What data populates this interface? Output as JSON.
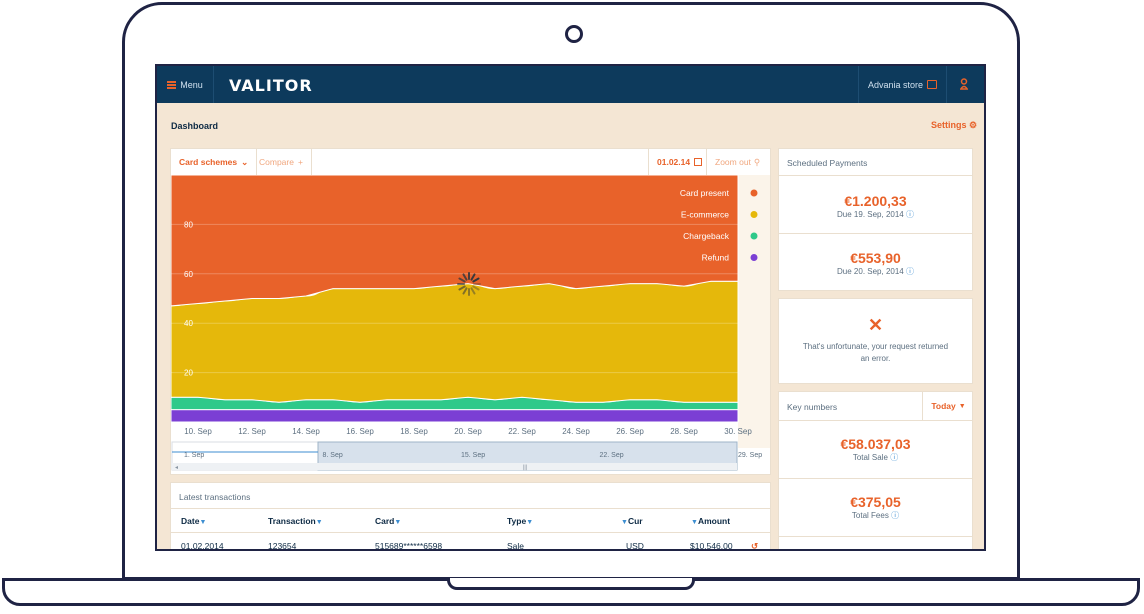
{
  "app": {
    "menu_label": "Menu",
    "logo": "VALITOR",
    "store_label": "Advania store"
  },
  "page": {
    "title": "Dashboard",
    "settings_label": "Settings"
  },
  "chart_toolbar": {
    "card_schemes": "Card schemes",
    "compare": "Compare",
    "date": "01.02.14",
    "zoom_out": "Zoom out"
  },
  "chart_data": {
    "type": "area",
    "stacked": true,
    "x": [
      "9 Sep",
      "10 Sep",
      "11 Sep",
      "12 Sep",
      "13 Sep",
      "14 Sep",
      "15 Sep",
      "16 Sep",
      "17 Sep",
      "18 Sep",
      "19 Sep",
      "20 Sep",
      "21 Sep",
      "22 Sep",
      "23 Sep",
      "24 Sep",
      "25 Sep",
      "26 Sep",
      "27 Sep",
      "28 Sep",
      "29 Sep",
      "30 Sep"
    ],
    "x_tick_labels": [
      "10. Sep",
      "12. Sep",
      "14. Sep",
      "16. Sep",
      "18. Sep",
      "20. Sep",
      "22. Sep",
      "24. Sep",
      "26. Sep",
      "28. Sep",
      "30. Sep"
    ],
    "y_ticks": [
      "20",
      "40",
      "60",
      "80"
    ],
    "ylim": [
      0,
      100
    ],
    "grid": true,
    "legend_position": "top-right",
    "series": [
      {
        "name": "Refund",
        "color": "#7b3fd4",
        "values": [
          5,
          5,
          5,
          5,
          5,
          5,
          5,
          5,
          5,
          5,
          5,
          5,
          5,
          5,
          5,
          5,
          5,
          5,
          5,
          5,
          5,
          5
        ]
      },
      {
        "name": "Chargeback",
        "color": "#2ec98a",
        "values": [
          5,
          5,
          4,
          4,
          3,
          4,
          4,
          3,
          4,
          4,
          4,
          5,
          4,
          5,
          4,
          3,
          3,
          4,
          4,
          3,
          3,
          3
        ]
      },
      {
        "name": "E-commerce",
        "color": "#e5b80b",
        "values": [
          37,
          38,
          40,
          41,
          42,
          42,
          45,
          46,
          45,
          45,
          46,
          46,
          45,
          45,
          47,
          46,
          47,
          47,
          47,
          47,
          49,
          49
        ]
      },
      {
        "name": "Card present",
        "color": "#e8622a",
        "values": [
          53,
          52,
          51,
          50,
          50,
          49,
          46,
          46,
          46,
          46,
          45,
          44,
          46,
          45,
          44,
          46,
          45,
          44,
          44,
          45,
          43,
          43
        ]
      }
    ],
    "navigator_labels": [
      "1. Sep",
      "8. Sep",
      "15. Sep",
      "22. Sep",
      "29. Sep"
    ]
  },
  "scheduled_payments": {
    "title": "Scheduled Payments",
    "items": [
      {
        "amount": "€1.200,33",
        "due": "Due 19. Sep, 2014"
      },
      {
        "amount": "€553,90",
        "due": "Due 20. Sep, 2014"
      }
    ]
  },
  "error_card": {
    "message_line1": "That's unfortunate, your request returned",
    "message_line2": "an error."
  },
  "key_numbers": {
    "title": "Key numbers",
    "period": "Today",
    "items": [
      {
        "amount": "€58.037,03",
        "label": "Total Sale"
      },
      {
        "amount": "€375,05",
        "label": "Total Fees"
      }
    ]
  },
  "transactions": {
    "title": "Latest transactions",
    "columns": [
      "Date",
      "Transaction",
      "Card",
      "Type",
      "Cur",
      "Amount"
    ],
    "rows": [
      {
        "date": "01.02.2014",
        "transaction": "123654",
        "card": "515689******6598",
        "type": "Sale",
        "cur": "USD",
        "amount": "$10,546.00"
      }
    ]
  },
  "colors": {
    "accent": "#e8622a",
    "navy": "#0d3a5c",
    "background": "#f4e6d4"
  }
}
